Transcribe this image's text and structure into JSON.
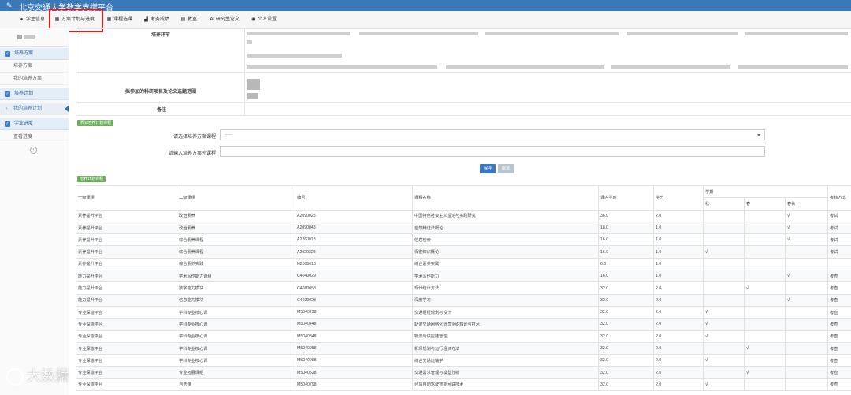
{
  "topbar": {
    "title": "北京交通大学教学支撑平台"
  },
  "nav": [
    {
      "label": "学生信息",
      "icon": "info-icon"
    },
    {
      "label": "方案计划与进度",
      "icon": "calendar-icon"
    },
    {
      "label": "课程选课",
      "icon": "calendar-icon"
    },
    {
      "label": "考务成绩",
      "icon": "bar-chart-icon"
    },
    {
      "label": "教室",
      "icon": "building-icon"
    },
    {
      "label": "研究生论文",
      "icon": "gears-icon"
    },
    {
      "label": "个人设置",
      "icon": "globe-icon"
    }
  ],
  "sidebar": {
    "groups": [
      {
        "label": "培养方案",
        "items": [
          {
            "label": "培养方案"
          },
          {
            "label": "我的培养方案"
          }
        ]
      },
      {
        "label": "培养计划",
        "items": [
          {
            "label": "我的培养计划",
            "active": true
          }
        ]
      },
      {
        "label": "学业进度",
        "items": [
          {
            "label": "查看进度"
          }
        ]
      }
    ],
    "collapse_icon": "chevron-left-icon"
  },
  "info": {
    "label_1": "培养环节",
    "label_2": "拟参加的科研项目及论文选题范围",
    "label_3": "备注"
  },
  "form": {
    "tag": "添加培养计划课程",
    "select_label": "请选择培养方案课程",
    "select_placeholder": "------",
    "input_label": "请输入培养方案外课程",
    "save": "保存",
    "cancel": "取消"
  },
  "table": {
    "tag": "培养计划课程",
    "headers": [
      "一级课组",
      "二级课组",
      "编号",
      "课程名称",
      "课内学时",
      "学分",
      "学期",
      "考核方式"
    ],
    "terms": [
      "秋",
      "春",
      "春秋"
    ],
    "rows": [
      [
        "素养提升平台",
        "政治素养",
        "A2090028",
        "中国特色社会主义理论与实践研究",
        "36.0",
        "2.0",
        "",
        "",
        "√",
        "考试"
      ],
      [
        "素养提升平台",
        "政治素养",
        "A2090048",
        "自然辩证法概论",
        "18.0",
        "1.0",
        "",
        "",
        "√",
        "考试"
      ],
      [
        "素养提升平台",
        "综合素养课程",
        "A2260018",
        "信息检索",
        "16.0",
        "1.0",
        "",
        "",
        "√",
        "考试"
      ],
      [
        "素养提升平台",
        "综合素养课程",
        "A2020328",
        "保密知识概论",
        "16.0",
        "1.0",
        "√",
        "",
        "",
        "考试"
      ],
      [
        "素养提升平台",
        "综合素养实践",
        "H2005018",
        "综合素养实践",
        "0.0",
        "1.0",
        "",
        "",
        "",
        ""
      ],
      [
        "能力提升平台",
        "学术写作能力课组",
        "C4040029",
        "学术写作能力",
        "16.0",
        "1.0",
        "",
        "",
        "√",
        "考查"
      ],
      [
        "能力提升平台",
        "数字能力模块",
        "C4080058",
        "现代统计方法",
        "32.0",
        "2.0",
        "",
        "√",
        "",
        "考查"
      ],
      [
        "能力提升平台",
        "信息能力模块",
        "C4020028",
        "深度学习",
        "32.0",
        "2.0",
        "",
        "",
        "√",
        "考查"
      ],
      [
        "专业深造平台",
        "学科专业核心课",
        "M5040298",
        "交通枢纽规划与设计",
        "32.0",
        "2.0",
        "√",
        "",
        "",
        "考查"
      ],
      [
        "专业深造平台",
        "学科专业核心课",
        "M5040448",
        "轨道交通网络化运营组织理论与技术",
        "32.0",
        "2.0",
        "√",
        "",
        "",
        "考查"
      ],
      [
        "专业深造平台",
        "学科专业核心课",
        "M5040348",
        "物流与供应链管理",
        "32.0",
        "2.0",
        "√",
        "",
        "",
        "考查"
      ],
      [
        "专业深造平台",
        "学科专业核心课",
        "M5040058",
        "机场规划与运行组织方法",
        "32.0",
        "2.0",
        "",
        "√",
        "",
        "考查"
      ],
      [
        "专业深造平台",
        "学科专业核心课",
        "M5040968",
        "综合交通运输学",
        "32.0",
        "2.0",
        "√",
        "",
        "",
        "考查"
      ],
      [
        "专业深造平台",
        "专业拓展课组",
        "M5040528",
        "交通需求管理与模型分析",
        "32.0",
        "2.0",
        "",
        "√",
        "",
        "考查"
      ],
      [
        "专业深造平台",
        "自选课",
        "M5040798",
        "列车自动驾驶智能网联技术",
        "32.0",
        "2.0",
        "√",
        "",
        "",
        "考查"
      ]
    ]
  },
  "watermark": {
    "text": "大数据"
  }
}
